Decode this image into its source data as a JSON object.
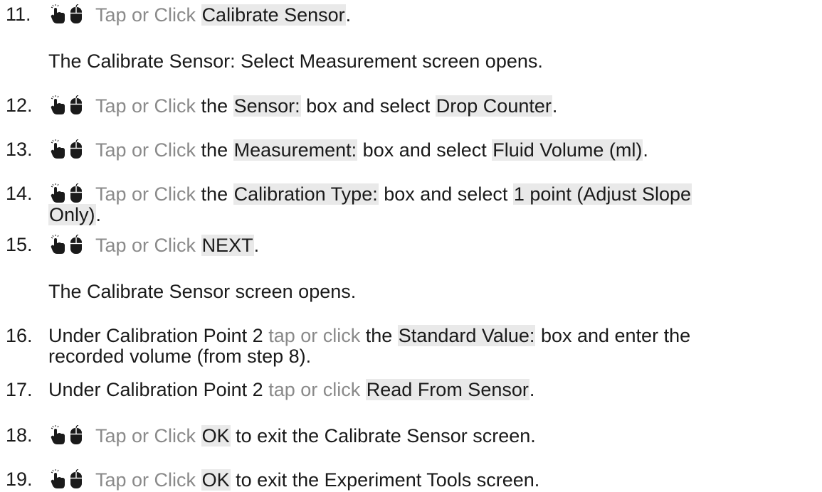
{
  "icons": {
    "tap": "finger-tap-icon",
    "click": "computer-mouse-icon"
  },
  "steps": [
    {
      "num": "11.",
      "has_icon": true,
      "segments": [
        {
          "text": "Tap or Click",
          "style": "gray"
        },
        {
          "text": " ",
          "style": "plain"
        },
        {
          "text": "Calibrate Sensor",
          "style": "ui"
        },
        {
          "text": ".",
          "style": "plain"
        }
      ]
    },
    {
      "note": true,
      "segments": [
        {
          "text": "The ",
          "style": "plain"
        },
        {
          "text": "Calibrate Sensor: Select Measurement",
          "style": "bold"
        },
        {
          "text": " screen opens.",
          "style": "plain"
        }
      ]
    },
    {
      "num": "12.",
      "has_icon": true,
      "segments": [
        {
          "text": "Tap or Click",
          "style": "gray"
        },
        {
          "text": " the ",
          "style": "plain"
        },
        {
          "text": "Sensor:",
          "style": "ui"
        },
        {
          "text": " box and select ",
          "style": "plain"
        },
        {
          "text": "Drop Counter",
          "style": "ui"
        },
        {
          "text": ".",
          "style": "plain"
        }
      ]
    },
    {
      "num": "13.",
      "has_icon": true,
      "segments": [
        {
          "text": "Tap or Click",
          "style": "gray"
        },
        {
          "text": " the ",
          "style": "plain"
        },
        {
          "text": "Measurement:",
          "style": "ui"
        },
        {
          "text": " box and select ",
          "style": "plain"
        },
        {
          "text": "Fluid Volume (ml)",
          "style": "ui"
        },
        {
          "text": ".",
          "style": "plain"
        }
      ]
    },
    {
      "num": "14.",
      "has_icon": true,
      "segments": [
        {
          "text": "Tap or Click",
          "style": "gray"
        },
        {
          "text": " the ",
          "style": "plain"
        },
        {
          "text": "Calibration Type:",
          "style": "ui"
        },
        {
          "text": " box and select ",
          "style": "plain"
        },
        {
          "text": "1 point (Adjust Slope",
          "style": "ui"
        },
        {
          "text": "\n",
          "style": "break"
        },
        {
          "text": "Only)",
          "style": "ui"
        },
        {
          "text": ".",
          "style": "plain"
        }
      ]
    },
    {
      "num": "15.",
      "has_icon": true,
      "segments": [
        {
          "text": "Tap or Click",
          "style": "gray"
        },
        {
          "text": " ",
          "style": "plain"
        },
        {
          "text": "NEXT",
          "style": "ui"
        },
        {
          "text": ".",
          "style": "plain"
        }
      ]
    },
    {
      "note": true,
      "segments": [
        {
          "text": "The ",
          "style": "plain"
        },
        {
          "text": "Calibrate Sensor",
          "style": "bold"
        },
        {
          "text": " screen opens.",
          "style": "plain"
        }
      ]
    },
    {
      "num": "16.",
      "has_icon": false,
      "segments": [
        {
          "text": "Under ",
          "style": "plain"
        },
        {
          "text": "Calibration Point 2",
          "style": "bold"
        },
        {
          "text": " ",
          "style": "plain"
        },
        {
          "text": "tap or click",
          "style": "gray"
        },
        {
          "text": " the ",
          "style": "plain"
        },
        {
          "text": "Standard Value:",
          "style": "ui"
        },
        {
          "text": " box and enter the",
          "style": "plain"
        },
        {
          "text": "\n",
          "style": "break"
        },
        {
          "text": "recorded volume (from step 8).",
          "style": "plain"
        }
      ]
    },
    {
      "num": "17.",
      "has_icon": false,
      "segments": [
        {
          "text": "Under ",
          "style": "plain"
        },
        {
          "text": "Calibration Point 2",
          "style": "bold"
        },
        {
          "text": " ",
          "style": "plain"
        },
        {
          "text": "tap or click",
          "style": "gray"
        },
        {
          "text": " ",
          "style": "plain"
        },
        {
          "text": "Read From Sensor",
          "style": "ui"
        },
        {
          "text": ".",
          "style": "plain"
        }
      ]
    },
    {
      "num": "18.",
      "has_icon": true,
      "segments": [
        {
          "text": "Tap or Click",
          "style": "gray"
        },
        {
          "text": " ",
          "style": "plain"
        },
        {
          "text": "OK",
          "style": "ui"
        },
        {
          "text": " to exit the ",
          "style": "plain"
        },
        {
          "text": "Calibrate Sensor",
          "style": "bold"
        },
        {
          "text": " screen.",
          "style": "plain"
        }
      ]
    },
    {
      "num": "19.",
      "has_icon": true,
      "segments": [
        {
          "text": "Tap or Click",
          "style": "gray"
        },
        {
          "text": " ",
          "style": "plain"
        },
        {
          "text": "OK",
          "style": "ui"
        },
        {
          "text": " to exit the ",
          "style": "plain"
        },
        {
          "text": "Experiment Tools",
          "style": "bold"
        },
        {
          "text": " screen.",
          "style": "plain"
        }
      ]
    }
  ]
}
